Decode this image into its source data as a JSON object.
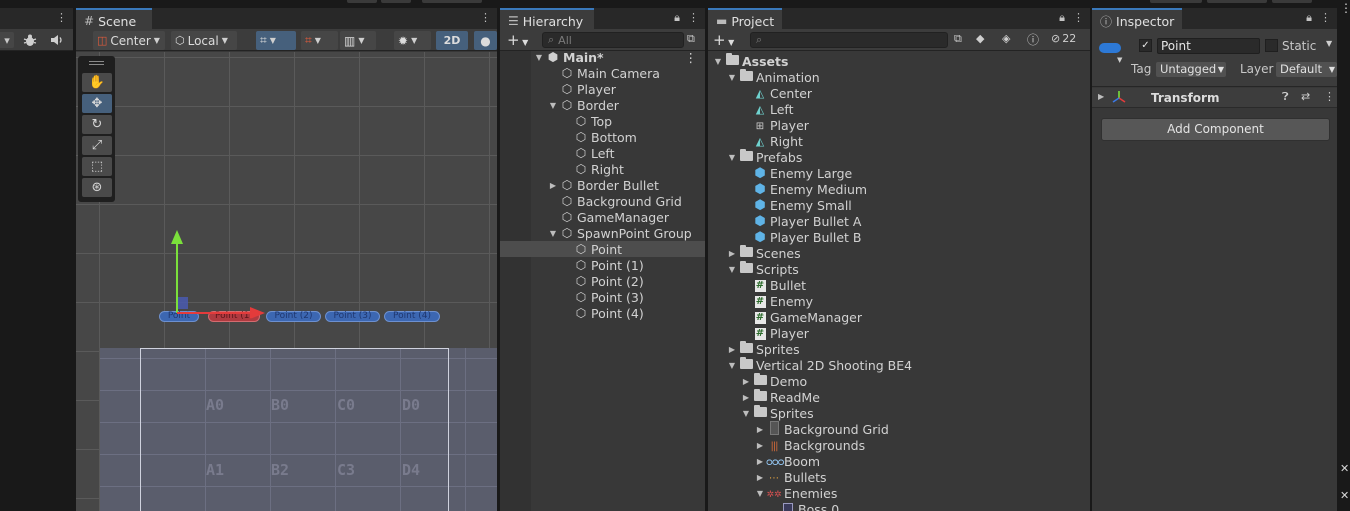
{
  "left_panel": {
    "toolbar_icons": [
      "caret-down-icon",
      "bug-icon",
      "audio-icon"
    ]
  },
  "scene": {
    "tab_title": "Scene",
    "pivot_mode": "Center",
    "pivot_rotation": "Local",
    "mode_2d": "2D",
    "grid_labels": [
      "A0",
      "B0",
      "C0",
      "D0",
      "A1",
      "B2",
      "C3",
      "D4"
    ],
    "point_labels": [
      "Point",
      "Point (1)",
      "Point (2)",
      "Point (3)",
      "Point (4)"
    ]
  },
  "hierarchy": {
    "tab_title": "Hierarchy",
    "search_placeholder": "All",
    "rows": [
      {
        "label": "Main*",
        "depth": 0,
        "arrow": "down",
        "icon": "unity-scene",
        "selected": false
      },
      {
        "label": "Main Camera",
        "depth": 1,
        "arrow": "",
        "selected": false
      },
      {
        "label": "Player",
        "depth": 1,
        "arrow": "",
        "selected": false
      },
      {
        "label": "Border",
        "depth": 1,
        "arrow": "down",
        "selected": false
      },
      {
        "label": "Top",
        "depth": 2,
        "arrow": "",
        "selected": false
      },
      {
        "label": "Bottom",
        "depth": 2,
        "arrow": "",
        "selected": false
      },
      {
        "label": "Left",
        "depth": 2,
        "arrow": "",
        "selected": false
      },
      {
        "label": "Right",
        "depth": 2,
        "arrow": "",
        "selected": false
      },
      {
        "label": "Border Bullet",
        "depth": 1,
        "arrow": "right",
        "selected": false
      },
      {
        "label": "Background Grid",
        "depth": 1,
        "arrow": "",
        "selected": false
      },
      {
        "label": "GameManager",
        "depth": 1,
        "arrow": "",
        "selected": false
      },
      {
        "label": "SpawnPoint Group",
        "depth": 1,
        "arrow": "down",
        "selected": false
      },
      {
        "label": "Point",
        "depth": 2,
        "arrow": "",
        "selected": true
      },
      {
        "label": "Point (1)",
        "depth": 2,
        "arrow": "",
        "selected": false
      },
      {
        "label": "Point (2)",
        "depth": 2,
        "arrow": "",
        "selected": false
      },
      {
        "label": "Point (3)",
        "depth": 2,
        "arrow": "",
        "selected": false
      },
      {
        "label": "Point (4)",
        "depth": 2,
        "arrow": "",
        "selected": false
      }
    ]
  },
  "project": {
    "tab_title": "Project",
    "hidden_count": "22",
    "rows": [
      {
        "label": "Assets",
        "depth": 0,
        "arrow": "down",
        "icon": "folder",
        "bold": true
      },
      {
        "label": "Animation",
        "depth": 1,
        "arrow": "down",
        "icon": "folder"
      },
      {
        "label": "Center",
        "depth": 2,
        "arrow": "",
        "icon": "anim"
      },
      {
        "label": "Left",
        "depth": 2,
        "arrow": "",
        "icon": "anim"
      },
      {
        "label": "Player",
        "depth": 2,
        "arrow": "",
        "icon": "animator"
      },
      {
        "label": "Right",
        "depth": 2,
        "arrow": "",
        "icon": "anim"
      },
      {
        "label": "Prefabs",
        "depth": 1,
        "arrow": "down",
        "icon": "folder"
      },
      {
        "label": "Enemy Large",
        "depth": 2,
        "arrow": "",
        "icon": "prefab"
      },
      {
        "label": "Enemy Medium",
        "depth": 2,
        "arrow": "",
        "icon": "prefab"
      },
      {
        "label": "Enemy Small",
        "depth": 2,
        "arrow": "",
        "icon": "prefab"
      },
      {
        "label": "Player Bullet A",
        "depth": 2,
        "arrow": "",
        "icon": "prefab"
      },
      {
        "label": "Player Bullet B",
        "depth": 2,
        "arrow": "",
        "icon": "prefab"
      },
      {
        "label": "Scenes",
        "depth": 1,
        "arrow": "right",
        "icon": "folder"
      },
      {
        "label": "Scripts",
        "depth": 1,
        "arrow": "down",
        "icon": "folder"
      },
      {
        "label": "Bullet",
        "depth": 2,
        "arrow": "",
        "icon": "script"
      },
      {
        "label": "Enemy",
        "depth": 2,
        "arrow": "",
        "icon": "script"
      },
      {
        "label": "GameManager",
        "depth": 2,
        "arrow": "",
        "icon": "script"
      },
      {
        "label": "Player",
        "depth": 2,
        "arrow": "",
        "icon": "script"
      },
      {
        "label": "Sprites",
        "depth": 1,
        "arrow": "right",
        "icon": "folder"
      },
      {
        "label": "Vertical 2D Shooting BE4",
        "depth": 1,
        "arrow": "down",
        "icon": "folder"
      },
      {
        "label": "Demo",
        "depth": 2,
        "arrow": "right",
        "icon": "folder"
      },
      {
        "label": "ReadMe",
        "depth": 2,
        "arrow": "right",
        "icon": "folder"
      },
      {
        "label": "Sprites",
        "depth": 2,
        "arrow": "down",
        "icon": "folder"
      },
      {
        "label": "Background Grid",
        "depth": 3,
        "arrow": "right",
        "icon": "sprite-grid"
      },
      {
        "label": "Backgrounds",
        "depth": 3,
        "arrow": "right",
        "icon": "sprite-bg"
      },
      {
        "label": "Boom",
        "depth": 3,
        "arrow": "right",
        "icon": "sprite-boom"
      },
      {
        "label": "Bullets",
        "depth": 3,
        "arrow": "right",
        "icon": "sprite-bullets"
      },
      {
        "label": "Enemies",
        "depth": 3,
        "arrow": "down",
        "icon": "sprite-enemies"
      },
      {
        "label": "Boss 0",
        "depth": 4,
        "arrow": "",
        "icon": "sprite-boss"
      }
    ]
  },
  "inspector": {
    "tab_title": "Inspector",
    "object_name": "Point",
    "active_checked": true,
    "static_label": "Static",
    "tag_label": "Tag",
    "tag_value": "Untagged",
    "layer_label": "Layer",
    "layer_value": "Default",
    "component_title": "Transform",
    "add_component_label": "Add Component"
  },
  "colors": {
    "accent": "#3a79bb",
    "selected_tool": "#46607c",
    "prefab": "#5fb3e6",
    "gizmo_y": "#7be03b",
    "gizmo_x": "#e43b3b"
  }
}
